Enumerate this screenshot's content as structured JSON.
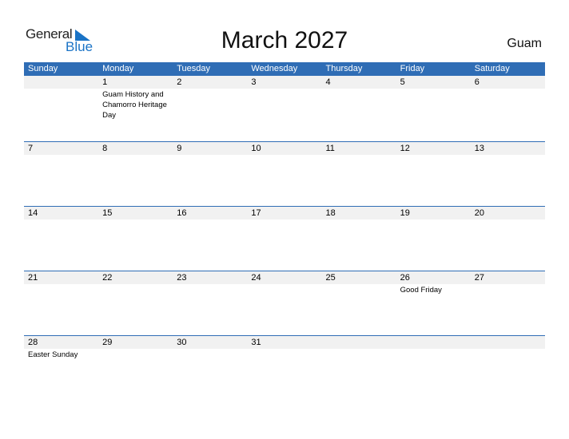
{
  "logo": {
    "text_general": "General",
    "text_blue": "Blue",
    "brand_color": "#1a73c6"
  },
  "title": "March 2027",
  "country": "Guam",
  "header_color": "#2f6db5",
  "weekdays": [
    "Sunday",
    "Monday",
    "Tuesday",
    "Wednesday",
    "Thursday",
    "Friday",
    "Saturday"
  ],
  "weeks": [
    {
      "days": [
        "",
        "1",
        "2",
        "3",
        "4",
        "5",
        "6"
      ],
      "events": [
        "",
        "Guam History and Chamorro Heritage Day",
        "",
        "",
        "",
        "",
        ""
      ]
    },
    {
      "days": [
        "7",
        "8",
        "9",
        "10",
        "11",
        "12",
        "13"
      ],
      "events": [
        "",
        "",
        "",
        "",
        "",
        "",
        ""
      ]
    },
    {
      "days": [
        "14",
        "15",
        "16",
        "17",
        "18",
        "19",
        "20"
      ],
      "events": [
        "",
        "",
        "",
        "",
        "",
        "",
        ""
      ]
    },
    {
      "days": [
        "21",
        "22",
        "23",
        "24",
        "25",
        "26",
        "27"
      ],
      "events": [
        "",
        "",
        "",
        "",
        "",
        "Good Friday",
        ""
      ]
    },
    {
      "days": [
        "28",
        "29",
        "30",
        "31",
        "",
        "",
        ""
      ],
      "events": [
        "Easter Sunday",
        "",
        "",
        "",
        "",
        "",
        ""
      ]
    }
  ]
}
